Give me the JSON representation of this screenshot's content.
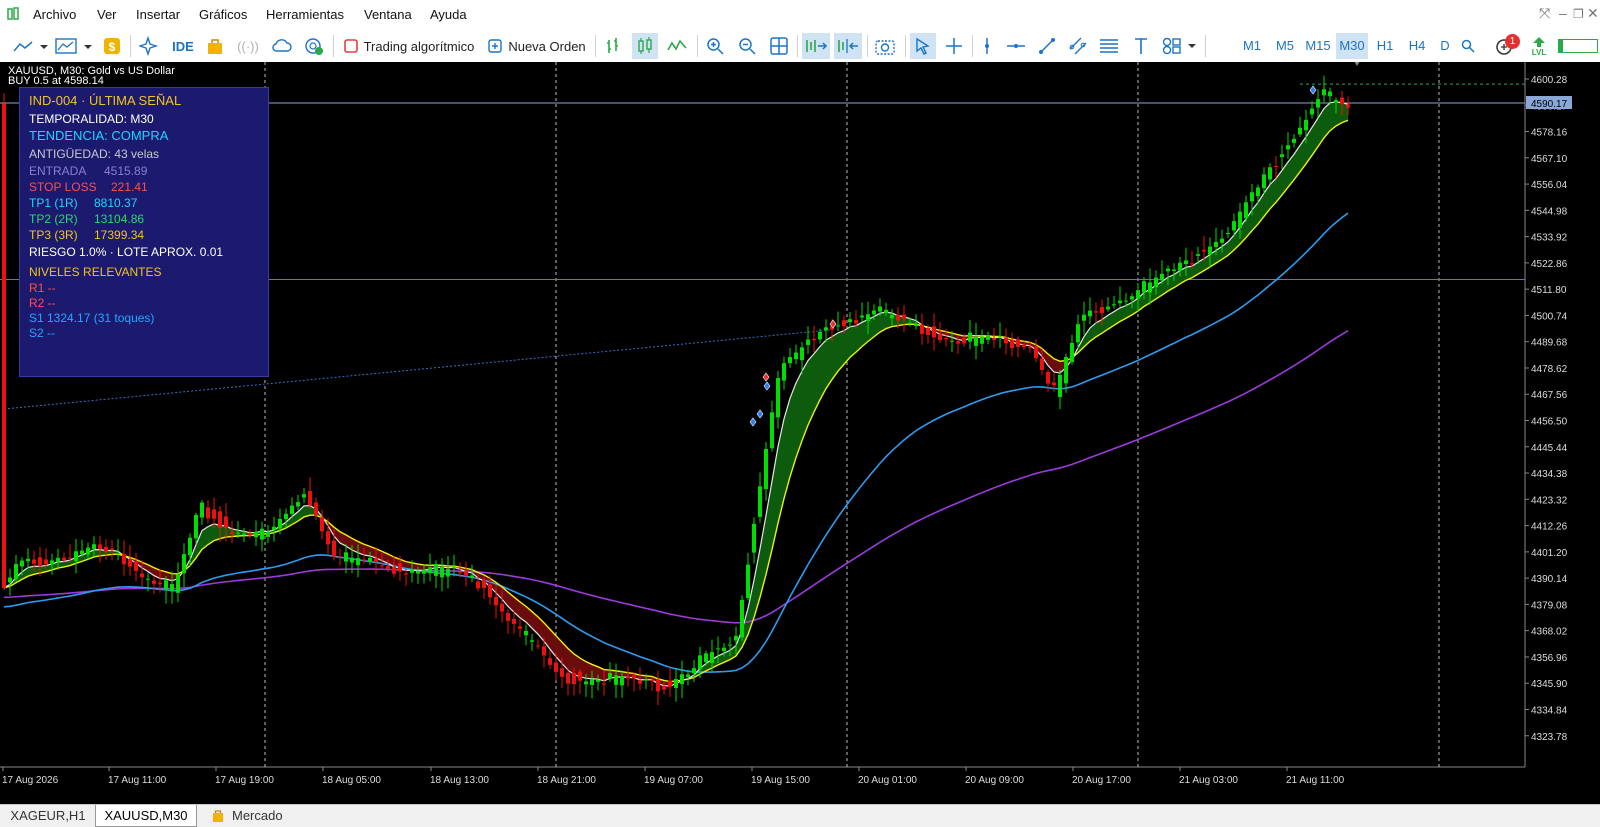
{
  "menu": {
    "items": [
      "Archivo",
      "Ver",
      "Insertar",
      "Gráficos",
      "Herramientas",
      "Ventana",
      "Ayuda"
    ]
  },
  "toolbar": {
    "ide_label": "IDE",
    "algo_label": "Trading algorítmico",
    "order_label": "Nueva Orden",
    "timeframes": [
      "M1",
      "M5",
      "M15",
      "M30",
      "H1",
      "H4",
      "D"
    ],
    "active_timeframe": "M30",
    "notification_count": "1",
    "lvl_label": "LVL"
  },
  "chart": {
    "symbol_title": "XAUUSD, M30:  Gold vs US Dollar",
    "trade_line": "BUY 0.5 at 4598.14",
    "background": "#000000",
    "bull_color": "#00dd00",
    "bear_color": "#ee1111",
    "price_axis": [
      "4600.28",
      "4590.17",
      "4578.16",
      "4567.10",
      "4556.04",
      "4544.98",
      "4533.92",
      "4522.86",
      "4511.80",
      "4500.74",
      "4489.68",
      "4478.62",
      "4467.56",
      "4456.50",
      "4445.44",
      "4434.38",
      "4423.32",
      "4412.26",
      "4401.20",
      "4390.14",
      "4379.08",
      "4368.02",
      "4356.96",
      "4345.90",
      "4334.84",
      "4323.78"
    ],
    "current_price": "4590.17",
    "time_axis": [
      "17 Aug 2026",
      "17 Aug 11:00",
      "17 Aug 19:00",
      "18 Aug 05:00",
      "18 Aug 13:00",
      "18 Aug 21:00",
      "19 Aug 07:00",
      "19 Aug 15:00",
      "20 Aug 01:00",
      "20 Aug 09:00",
      "20 Aug 17:00",
      "21 Aug 03:00",
      "21 Aug 11:00"
    ]
  },
  "panel": {
    "title": "IND-004 · ÚLTIMA SEÑAL",
    "timeframe": "TEMPORALIDAD: M30",
    "trend": "TENDENCIA: COMPRA",
    "age": "ANTIGÜEDAD: 43 velas",
    "entry_label": "ENTRADA",
    "entry_value": "4515.89",
    "sl_label": "STOP LOSS",
    "sl_value": "221.41",
    "tp1_label": "TP1 (1R)",
    "tp1_value": "8810.37",
    "tp2_label": "TP2 (2R)",
    "tp2_value": "13104.86",
    "tp3_label": "TP3 (3R)",
    "tp3_value": "17399.34",
    "risk": "RIESGO 1.0% · LOTE APROX. 0.01",
    "levels_title": "NIVELES RELEVANTES",
    "r1": "R1  --",
    "r2": "R2  --",
    "s1": "S1  1324.17 (31 toques)",
    "s2": "S2  --"
  },
  "tabs": [
    "XAGEUR,H1",
    "XAUUSD,M30",
    "Mercado"
  ],
  "active_tab": "XAUUSD,M30"
}
